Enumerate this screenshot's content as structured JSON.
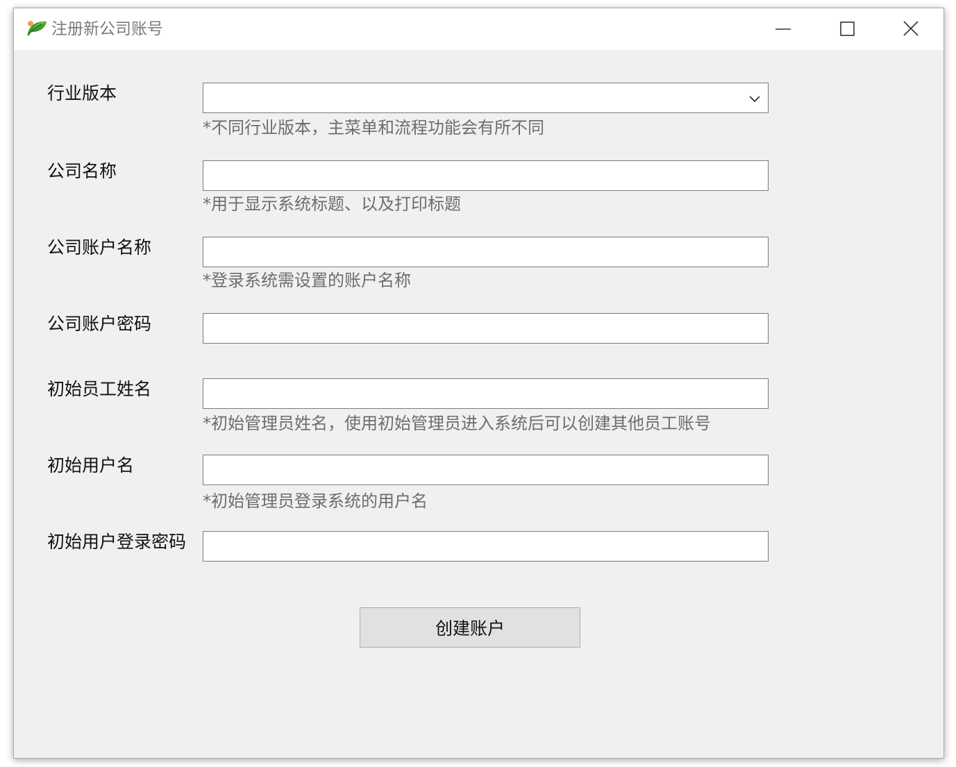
{
  "window": {
    "title": "注册新公司账号",
    "app_icon": "leaf-icon",
    "controls": {
      "minimize": "minimize-icon",
      "maximize": "maximize-icon",
      "close": "close-icon"
    }
  },
  "form": {
    "industry": {
      "label": "行业版本",
      "value": "",
      "hint": "*不同行业版本，主菜单和流程功能会有所不同"
    },
    "company_name": {
      "label": "公司名称",
      "value": "",
      "hint": "*用于显示系统标题、以及打印标题"
    },
    "account_name": {
      "label": "公司账户名称",
      "value": "",
      "hint": "*登录系统需设置的账户名称"
    },
    "account_password": {
      "label": "公司账户密码",
      "value": ""
    },
    "employee_name": {
      "label": "初始员工姓名",
      "value": "",
      "hint": "*初始管理员姓名，使用初始管理员进入系统后可以创建其他员工账号"
    },
    "username": {
      "label": "初始用户名",
      "value": "",
      "hint": "*初始管理员登录系统的用户名"
    },
    "user_password": {
      "label": "初始用户登录密码",
      "value": ""
    }
  },
  "actions": {
    "create_label": "创建账户"
  },
  "colors": {
    "window_bg": "#f0f0f0",
    "titlebar_bg": "#ffffff",
    "hint_text": "#6d6d6d",
    "button_bg": "#e1e1e1"
  }
}
